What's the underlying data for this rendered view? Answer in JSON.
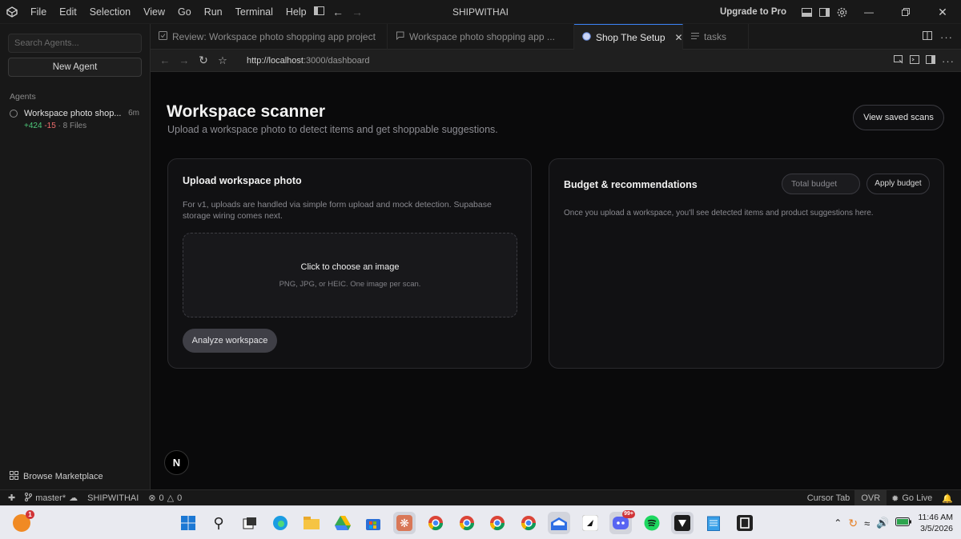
{
  "titlebar": {
    "menu": [
      "File",
      "Edit",
      "Selection",
      "View",
      "Go",
      "Run",
      "Terminal",
      "Help"
    ],
    "title": "SHIPWITHAI",
    "upgrade_label": "Upgrade to Pro"
  },
  "sidebar": {
    "search_placeholder": "Search Agents...",
    "new_agent_label": "New Agent",
    "section_label": "Agents",
    "agents": [
      {
        "title": "Workspace photo shop...",
        "time": "6m",
        "added": "+424",
        "removed": "-15",
        "files": "· 8 Files"
      }
    ],
    "marketplace_label": "Browse Marketplace"
  },
  "tabs": [
    {
      "label": "Review: Workspace photo shopping app project",
      "icon": "review-icon",
      "active": false
    },
    {
      "label": "Workspace photo shopping app ...",
      "icon": "chat-icon",
      "active": false
    },
    {
      "label": "Shop The Setup",
      "icon": "globe-icon",
      "active": true
    },
    {
      "label": "tasks",
      "icon": "list-icon",
      "active": false
    }
  ],
  "browser": {
    "url_host": "http://localhost",
    "url_path": ":3000/dashboard"
  },
  "page": {
    "title": "Workspace scanner",
    "subtitle": "Upload a workspace photo to detect items and get shoppable suggestions.",
    "view_saved_label": "View saved scans",
    "upload_card": {
      "title": "Upload workspace photo",
      "description": "For v1, uploads are handled via simple form upload and mock detection. Supabase storage wiring comes next.",
      "dropzone_title": "Click to choose an image",
      "dropzone_sub": "PNG, JPG, or HEIC. One image per scan.",
      "analyze_label": "Analyze workspace"
    },
    "budget_card": {
      "title": "Budget & recommendations",
      "budget_placeholder": "Total budget",
      "apply_label": "Apply budget",
      "message": "Once you upload a workspace, you'll see detected items and product suggestions here."
    },
    "framework_badge": "N"
  },
  "statusbar": {
    "branch": "master*",
    "project": "SHIPWITHAI",
    "errors": "0",
    "warnings": "0",
    "cursor_tab": "Cursor Tab",
    "ovr": "OVR",
    "go_live": "Go Live"
  },
  "taskbar": {
    "notification_badge": "1",
    "badge_99": "99+",
    "time": "11:46 AM",
    "date": "3/5/2026"
  },
  "colors": {
    "accent_blue": "#3b82f6",
    "added_green": "#4ec97a",
    "removed_red": "#f06d6d",
    "page_bg": "#0a0a0b"
  }
}
